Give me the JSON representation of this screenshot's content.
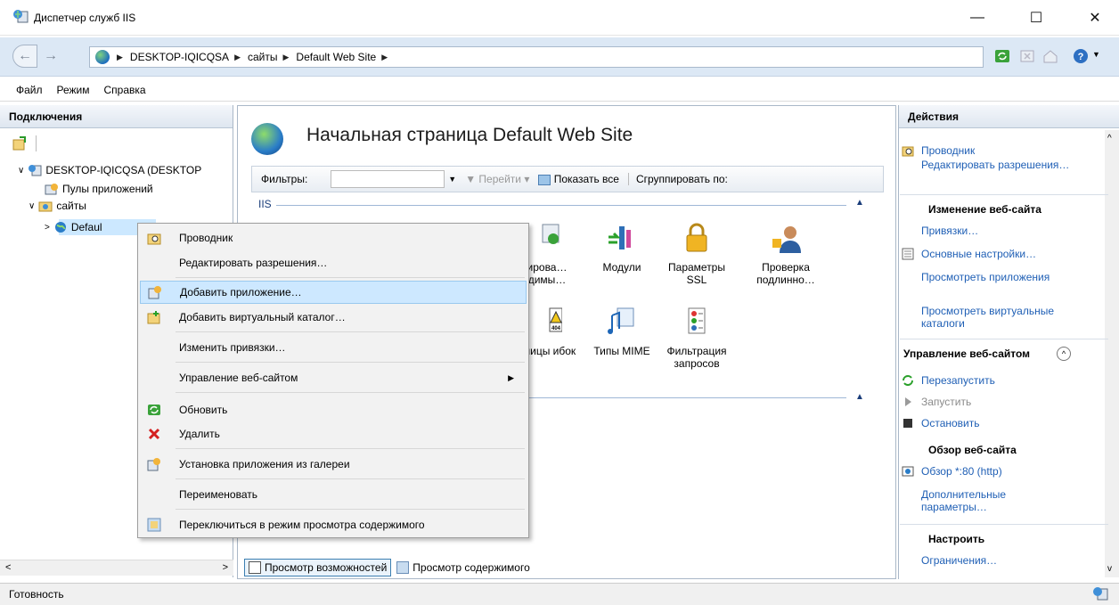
{
  "window": {
    "title": "Диспетчер служб IIS",
    "minimize": "—",
    "maximize": "☐",
    "close": "✕"
  },
  "address": {
    "crumbs": [
      "DESKTOP-IQICQSA",
      "сайты",
      "Default Web Site"
    ],
    "sep": "▶"
  },
  "menubar": [
    "Файл",
    "Режим",
    "Справка"
  ],
  "left": {
    "header": "Подключения",
    "tree": [
      {
        "label": "DESKTOP-IQICQSA (DESKTOP",
        "toggle": "∨"
      },
      {
        "label": "Пулы приложений"
      },
      {
        "label": "сайты",
        "toggle": "∨"
      },
      {
        "label": "Defaul",
        "toggle": ">"
      }
    ]
  },
  "center": {
    "title": "Начальная страница Default Web Site",
    "filters_label": "Фильтры:",
    "goto": "Перейти",
    "show_all": "Показать все",
    "group_by": "Сгруппировать по:",
    "group_iis": "IIS",
    "features": [
      {
        "label": "ирова… димы…"
      },
      {
        "label": "Модули"
      },
      {
        "label": "Параметры SSL"
      },
      {
        "label": "Проверка подлинно…"
      },
      {
        "label": "аницы ибок"
      },
      {
        "label": "Типы MIME"
      },
      {
        "label": "Фильтрация запросов"
      }
    ],
    "tab_features": "Просмотр возможностей",
    "tab_content": "Просмотр содержимого"
  },
  "actions": {
    "header": "Действия",
    "explore": "Проводник",
    "edit_perm": "Редактировать разрешения…",
    "edit_site": "Изменение веб-сайта",
    "bindings": "Привязки…",
    "basic": "Основные настройки…",
    "view_apps": "Просмотреть приложения",
    "view_vdirs": "Просмотреть виртуальные каталоги",
    "manage": "Управление веб-сайтом",
    "restart": "Перезапустить",
    "start": "Запустить",
    "stop": "Остановить",
    "browse_head": "Обзор веб-сайта",
    "browse": "Обзор *:80 (http)",
    "advanced": "Дополнительные параметры…",
    "configure": "Настроить",
    "limits": "Ограничения…"
  },
  "context_menu": [
    {
      "label": "Проводник"
    },
    {
      "label": "Редактировать разрешения…"
    },
    {
      "label": "Добавить приложение…",
      "highlighted": true
    },
    {
      "label": "Добавить виртуальный каталог…"
    },
    {
      "label": "Изменить привязки…"
    },
    {
      "label": "Управление веб-сайтом",
      "submenu": "▶"
    },
    {
      "label": "Обновить"
    },
    {
      "label": "Удалить"
    },
    {
      "label": "Установка приложения из галереи"
    },
    {
      "label": "Переименовать"
    },
    {
      "label": "Переключиться в режим просмотра содержимого"
    }
  ],
  "status": "Готовность"
}
